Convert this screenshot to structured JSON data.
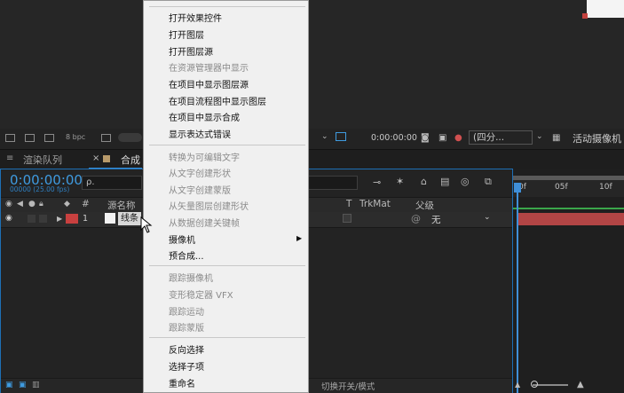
{
  "viewer": {
    "bpc": "8 bpc",
    "timecode": "0:00:00:00",
    "quality": "(四分...",
    "camera": "活动摄像机"
  },
  "tabs": {
    "render_queue": "渲染队列",
    "close": "×",
    "composition": "合成"
  },
  "timeline": {
    "current_time": "0:00:00:00",
    "frames": "00000 (25.00 fps)",
    "search_placeholder": "ρ.",
    "columns": {
      "num": "#",
      "source_name": "源名称",
      "t": "T",
      "trkmat": "TrkMat",
      "parent": "父级"
    },
    "layer": {
      "number": "1",
      "name": "线条",
      "parent_value": "无",
      "color": "#c8403f"
    },
    "ruler": [
      "0f",
      "05f",
      "10f"
    ],
    "switch_label": "切换开关/模式"
  },
  "context_menu": {
    "items": [
      {
        "label": "打开效果控件",
        "enabled": true
      },
      {
        "label": "打开图层",
        "enabled": true
      },
      {
        "label": "打开图层源",
        "enabled": true
      },
      {
        "label": "在资源管理器中显示",
        "enabled": false
      },
      {
        "label": "在项目中显示图层源",
        "enabled": true
      },
      {
        "label": "在项目流程图中显示图层",
        "enabled": true
      },
      {
        "label": "在项目中显示合成",
        "enabled": true
      },
      {
        "label": "显示表达式错误",
        "enabled": true
      },
      {
        "label": "转换为可编辑文字",
        "enabled": false
      },
      {
        "label": "从文字创建形状",
        "enabled": false
      },
      {
        "label": "从文字创建蒙版",
        "enabled": false
      },
      {
        "label": "从矢量图层创建形状",
        "enabled": false
      },
      {
        "label": "从数据创建关键帧",
        "enabled": false
      },
      {
        "label": "摄像机",
        "enabled": true
      },
      {
        "label": "预合成...",
        "enabled": true
      },
      {
        "label": "跟踪摄像机",
        "enabled": false
      },
      {
        "label": "变形稳定器 VFX",
        "enabled": false
      },
      {
        "label": "跟踪运动",
        "enabled": false
      },
      {
        "label": "跟踪蒙版",
        "enabled": false
      },
      {
        "label": "反向选择",
        "enabled": true
      },
      {
        "label": "选择子项",
        "enabled": true
      },
      {
        "label": "重命名",
        "enabled": true
      }
    ]
  },
  "colors": {
    "accent_blue": "#3f9be0",
    "layer_red": "#c8403f",
    "menu_bg": "#f0f0f0"
  }
}
